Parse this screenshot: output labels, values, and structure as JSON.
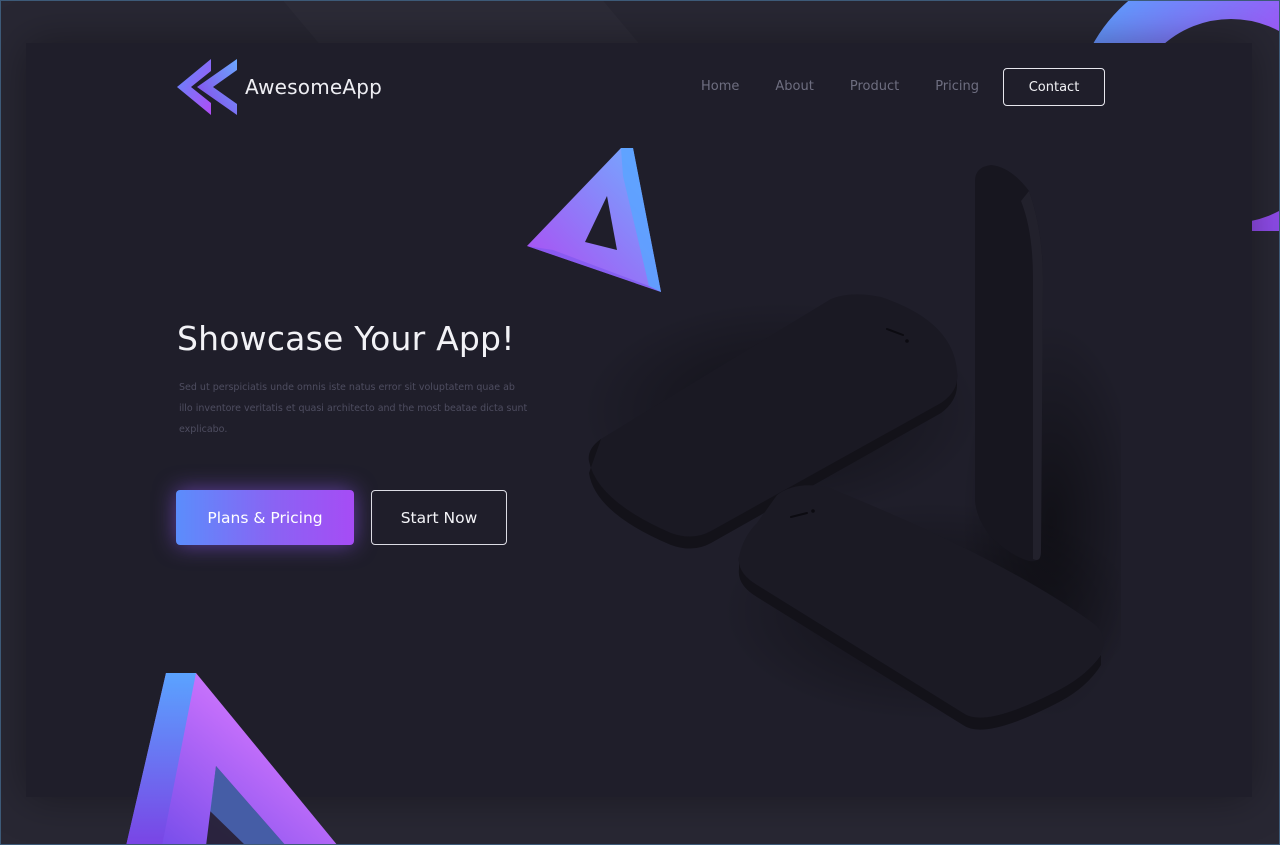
{
  "brand": {
    "name": "AwesomeApp",
    "logo_icon": "rewind-triangles-icon"
  },
  "nav": {
    "items": [
      {
        "label": "Home"
      },
      {
        "label": "About"
      },
      {
        "label": "Product"
      },
      {
        "label": "Pricing"
      }
    ],
    "contact_label": "Contact"
  },
  "hero": {
    "title": "Showcase Your App!",
    "description": "Sed ut perspiciatis unde omnis iste natus error sit voluptatem quae ab illo inventore veritatis et quasi architecto and the most beatae dicta sunt explicabo.",
    "primary_button": "Plans & Pricing",
    "secondary_button": "Start Now"
  },
  "colors": {
    "background": "#1f1e2a",
    "accent_blue": "#5b8dfc",
    "accent_purple": "#a64cf5"
  }
}
